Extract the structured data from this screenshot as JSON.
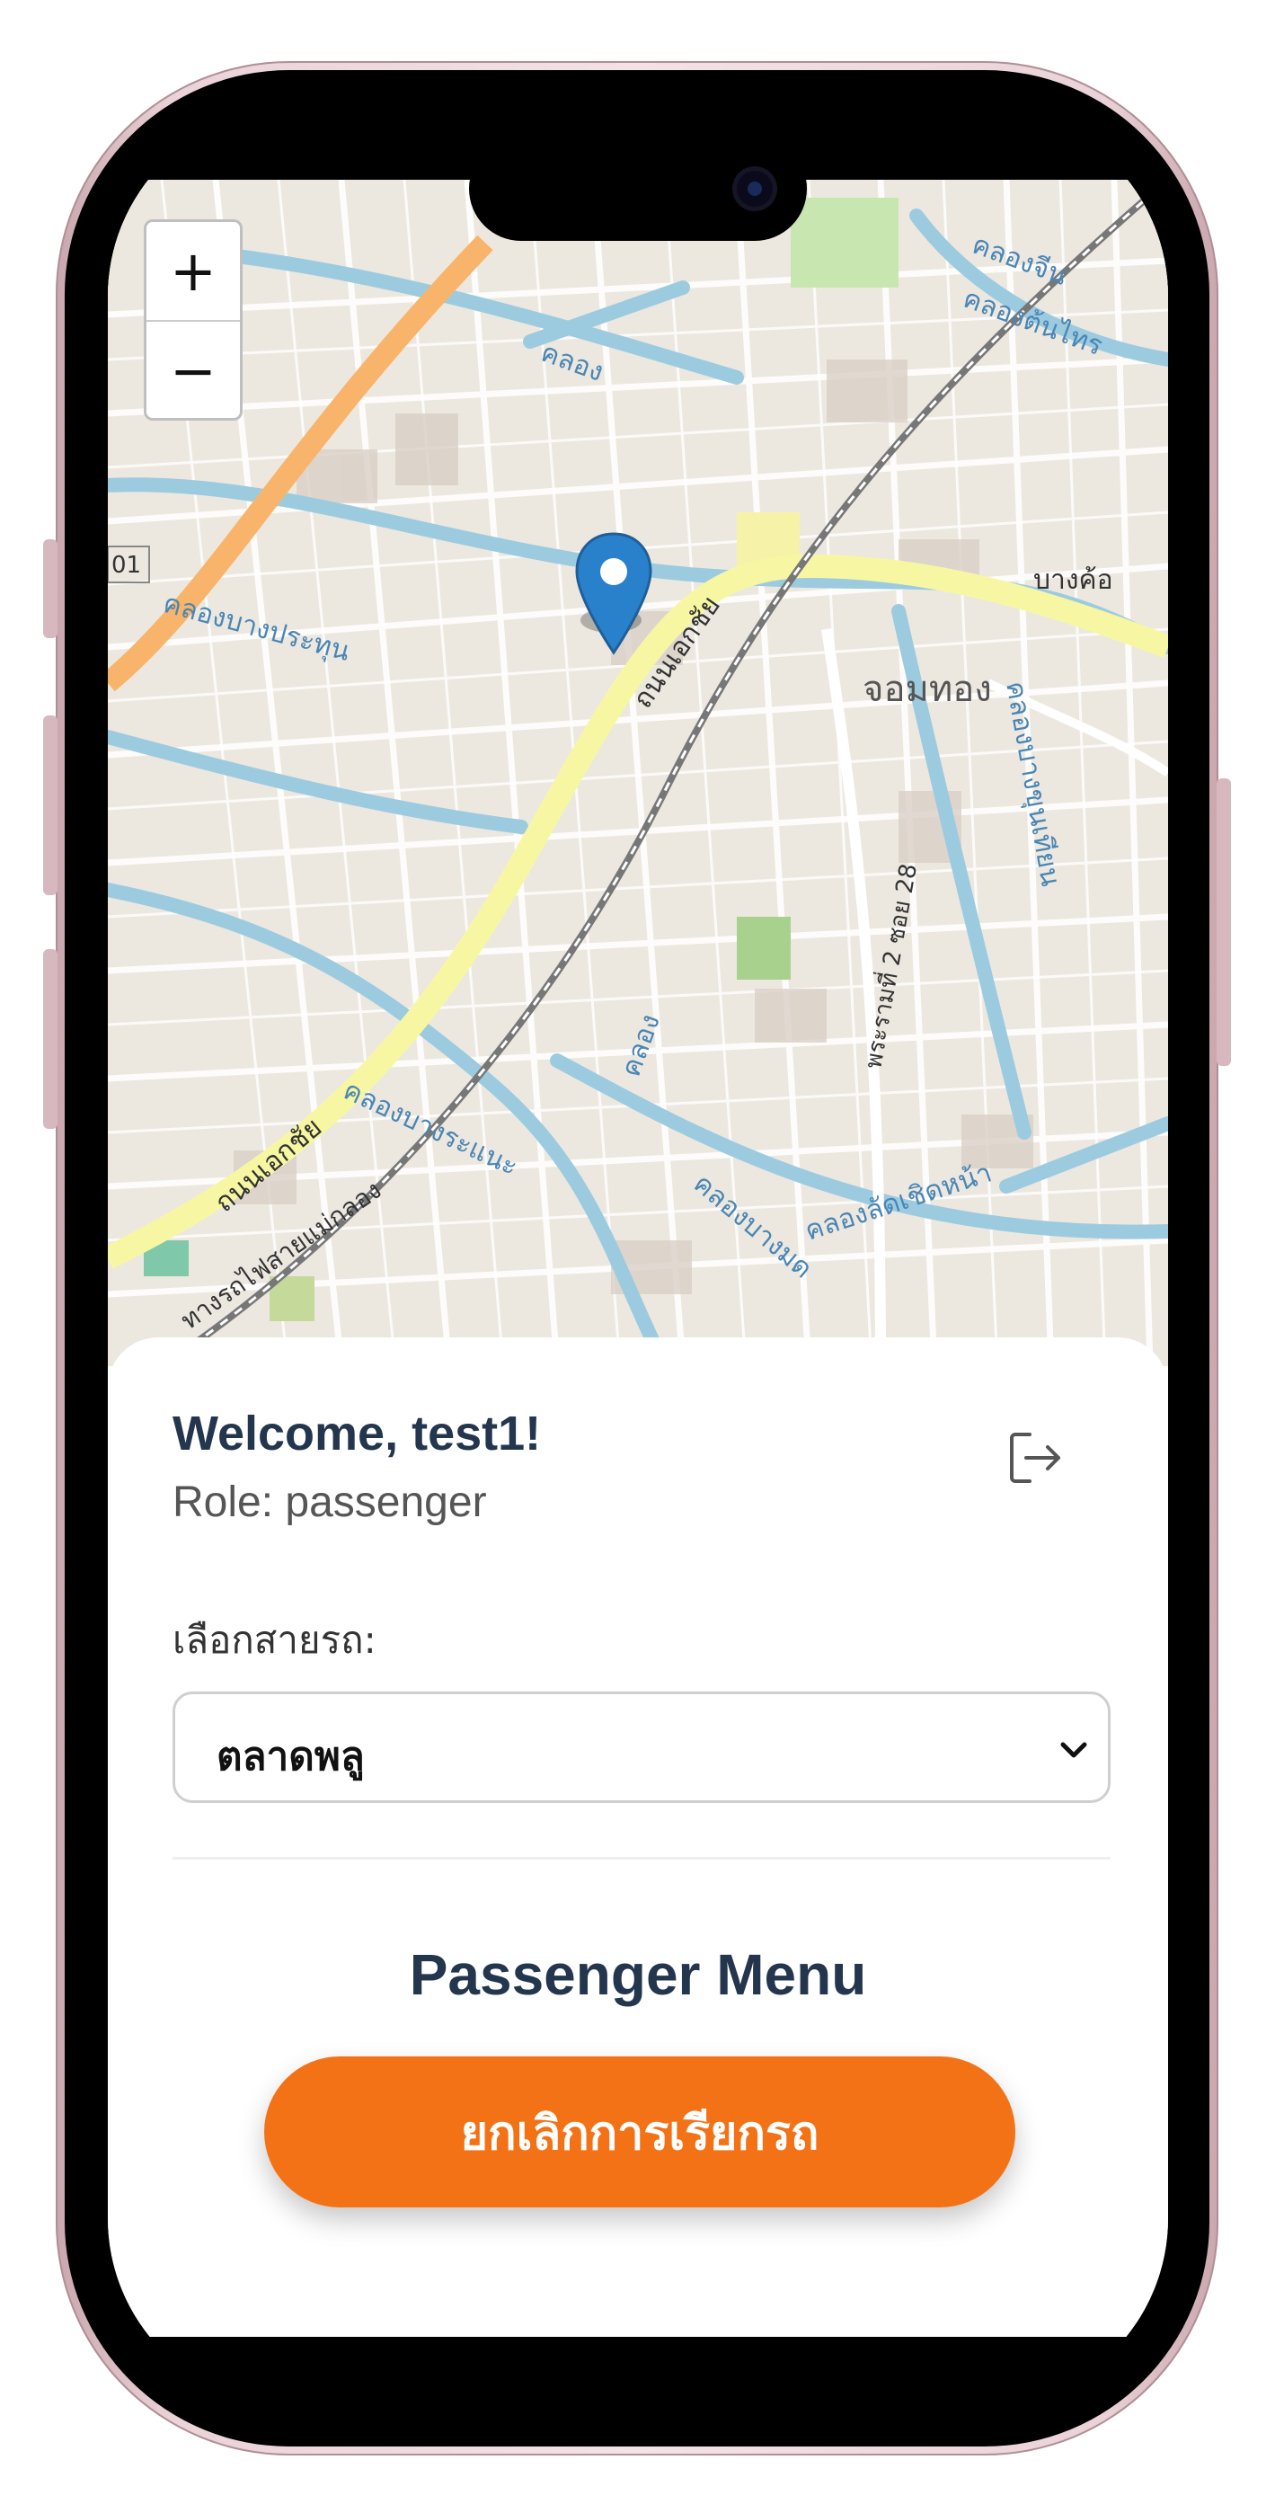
{
  "map": {
    "zoom_in_label": "+",
    "zoom_out_label": "−",
    "labels": [
      {
        "id": "canal-jin",
        "text": "คลองจีน"
      },
      {
        "id": "canal-tonsai",
        "text": "คลองต้นไทร"
      },
      {
        "id": "bang-kho",
        "text": "บางค้อ"
      },
      {
        "id": "chom-thong",
        "text": "จอมทอง"
      },
      {
        "id": "canal-bang-prakok",
        "text": "คลองบางประทุน"
      },
      {
        "id": "thanon-ekkachai",
        "text": "ถนนเอกชัย"
      },
      {
        "id": "thanon-ekkachai-2",
        "text": "ถนนเอกชัย"
      },
      {
        "id": "rama2-soi28",
        "text": "พระรามที่ 2 ซอย 28"
      },
      {
        "id": "canal-bang-nam-chon",
        "text": "คลองบางขุนเทียน"
      },
      {
        "id": "canal-bang-ramat",
        "text": "คลองบางระแนะ"
      },
      {
        "id": "canal-bang-mot",
        "text": "คลองบางมด"
      },
      {
        "id": "canal-lat-ket",
        "text": "คลองลัดเชิดหน้า"
      },
      {
        "id": "railway",
        "text": "ทางรถไฟสายแม่กลอง"
      },
      {
        "id": "canal-top",
        "text": "คลอง"
      },
      {
        "id": "canal-mid",
        "text": "คลอง"
      },
      {
        "id": "road-num",
        "text": "01"
      }
    ]
  },
  "panel": {
    "welcome": "Welcome, test1!",
    "role": "Role: passenger",
    "route_label": "เลือกสายรถ:",
    "route_selected": "ตลาดพลู",
    "menu_title": "Passenger Menu",
    "cancel_button": "ยกเลิกการเรียกรถ"
  },
  "colors": {
    "accent": "#f47216",
    "heading": "#23364d",
    "marker": "#2a81cb"
  }
}
